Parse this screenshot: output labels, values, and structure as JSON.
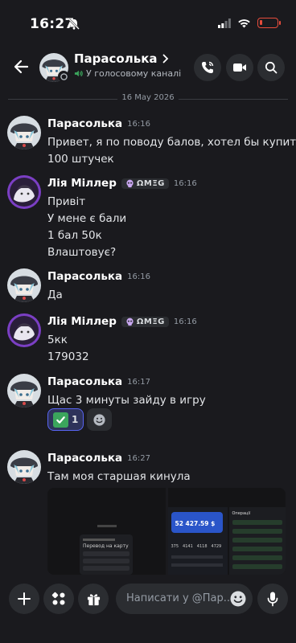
{
  "status_bar": {
    "time": "16:27"
  },
  "header": {
    "title": "Парасолька",
    "subtitle": "У голосовому каналі"
  },
  "date_separator": "16 May 2026",
  "messages": [
    {
      "author": "Парасолька",
      "time": "16:16",
      "lines": [
        "Привет, я по поводу балов, хотел бы купить",
        "100 штучек"
      ]
    },
    {
      "author": "Лія Міллер",
      "tag": "ΩMΞG",
      "time": "16:16",
      "lines": [
        "Привіт",
        "У мене є бали",
        "1 бал 50к",
        "Влаштовує?"
      ]
    },
    {
      "author": "Парасолька",
      "time": "16:16",
      "lines": [
        "Да"
      ]
    },
    {
      "author": "Лія Міллер",
      "tag": "ΩMΞG",
      "time": "16:16",
      "lines": [
        "5кк",
        "179032"
      ]
    },
    {
      "author": "Парасолька",
      "time": "16:17",
      "lines": [
        "Щас 3 минуты зайду в игру"
      ],
      "reaction_count": "1"
    },
    {
      "author": "Парасолька",
      "time": "16:27",
      "lines": [
        "Там моя старшая кинула"
      ]
    }
  ],
  "attachment": {
    "left": {
      "title": "Перевод на карту",
      "amount": "—"
    },
    "right": {
      "balance": "52 427.59 $",
      "card_digits": [
        "375",
        "4141",
        "4118",
        "4729"
      ],
      "operations_label": "Операції"
    }
  },
  "composer": {
    "placeholder": "Написати у @Пар..."
  }
}
